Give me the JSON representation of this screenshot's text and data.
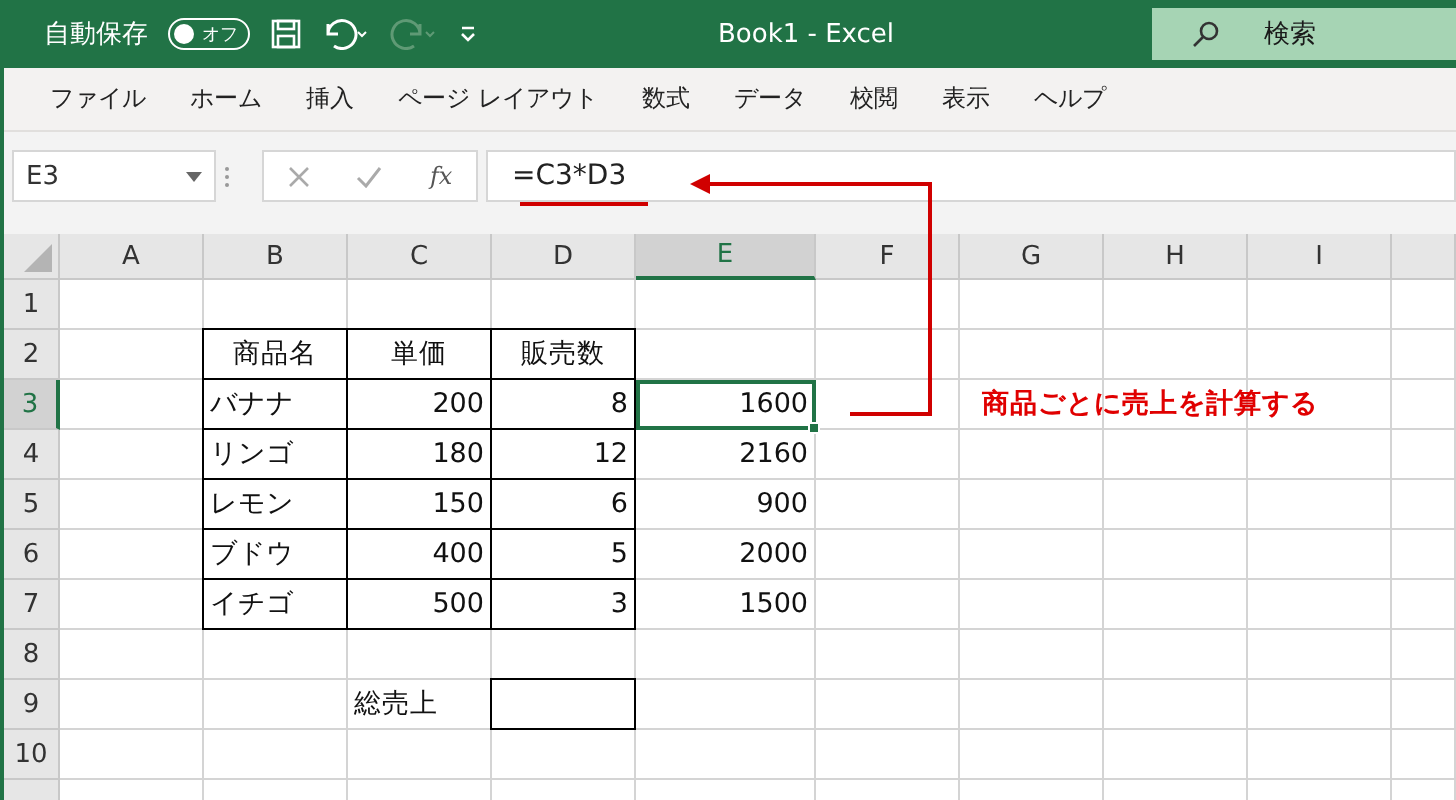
{
  "title_bar": {
    "autosave_label": "自動保存",
    "autosave_toggle": {
      "label": "オフ",
      "on": false
    },
    "redo_disabled": true,
    "title": "Book1  -  Excel",
    "search": {
      "placeholder": "検索"
    }
  },
  "menu": [
    "ファイル",
    "ホーム",
    "挿入",
    "ページ レイアウト",
    "数式",
    "データ",
    "校閲",
    "表示",
    "ヘルプ"
  ],
  "formula_bar": {
    "name_box": "E3",
    "fx": "fx",
    "formula": "=C3*D3"
  },
  "columns": [
    {
      "label": "A",
      "selected": false
    },
    {
      "label": "B",
      "selected": false
    },
    {
      "label": "C",
      "selected": false
    },
    {
      "label": "D",
      "selected": false
    },
    {
      "label": "E",
      "selected": true
    },
    {
      "label": "F",
      "selected": false
    },
    {
      "label": "G",
      "selected": false
    },
    {
      "label": "H",
      "selected": false
    },
    {
      "label": "I",
      "selected": false
    }
  ],
  "rows": [
    {
      "label": "1",
      "selected": false,
      "cells": []
    },
    {
      "label": "2",
      "selected": false,
      "cells": [
        null,
        {
          "kind": "header",
          "text": "商品名",
          "boxed": true,
          "selected": false
        },
        {
          "kind": "header",
          "text": "単価",
          "boxed": true,
          "selected": false
        },
        {
          "kind": "header",
          "text": "販売数",
          "boxed": true,
          "selected": false
        }
      ]
    },
    {
      "label": "3",
      "selected": true,
      "cells": [
        null,
        {
          "kind": "text",
          "text": "バナナ",
          "boxed": true,
          "selected": false
        },
        {
          "kind": "number",
          "text": "200",
          "boxed": true,
          "selected": false
        },
        {
          "kind": "number",
          "text": "8",
          "boxed": true,
          "selected": false
        },
        {
          "kind": "number",
          "text": "1600",
          "boxed": false,
          "selected": true
        },
        null,
        {
          "kind": "annotation",
          "text": "商品ごとに売上を計算する"
        }
      ]
    },
    {
      "label": "4",
      "selected": false,
      "cells": [
        null,
        {
          "kind": "text",
          "text": "リンゴ",
          "boxed": true,
          "selected": false
        },
        {
          "kind": "number",
          "text": "180",
          "boxed": true,
          "selected": false
        },
        {
          "kind": "number",
          "text": "12",
          "boxed": true,
          "selected": false
        },
        {
          "kind": "number",
          "text": "2160",
          "boxed": false,
          "selected": false
        }
      ]
    },
    {
      "label": "5",
      "selected": false,
      "cells": [
        null,
        {
          "kind": "text",
          "text": "レモン",
          "boxed": true,
          "selected": false
        },
        {
          "kind": "number",
          "text": "150",
          "boxed": true,
          "selected": false
        },
        {
          "kind": "number",
          "text": "6",
          "boxed": true,
          "selected": false
        },
        {
          "kind": "number",
          "text": "900",
          "boxed": false,
          "selected": false
        }
      ]
    },
    {
      "label": "6",
      "selected": false,
      "cells": [
        null,
        {
          "kind": "text",
          "text": "ブドウ",
          "boxed": true,
          "selected": false
        },
        {
          "kind": "number",
          "text": "400",
          "boxed": true,
          "selected": false
        },
        {
          "kind": "number",
          "text": "5",
          "boxed": true,
          "selected": false
        },
        {
          "kind": "number",
          "text": "2000",
          "boxed": false,
          "selected": false
        }
      ]
    },
    {
      "label": "7",
      "selected": false,
      "cells": [
        null,
        {
          "kind": "text",
          "text": "イチゴ",
          "boxed": true,
          "selected": false
        },
        {
          "kind": "number",
          "text": "500",
          "boxed": true,
          "selected": false
        },
        {
          "kind": "number",
          "text": "3",
          "boxed": true,
          "selected": false
        },
        {
          "kind": "number",
          "text": "1500",
          "boxed": false,
          "selected": false
        }
      ]
    },
    {
      "label": "8",
      "selected": false,
      "cells": []
    },
    {
      "label": "9",
      "selected": false,
      "cells": [
        null,
        null,
        {
          "kind": "text",
          "text": "総売上",
          "boxed": false,
          "selected": false
        },
        {
          "kind": "blank",
          "boxed": true,
          "selected": false
        }
      ]
    },
    {
      "label": "10",
      "selected": false,
      "cells": []
    }
  ]
}
